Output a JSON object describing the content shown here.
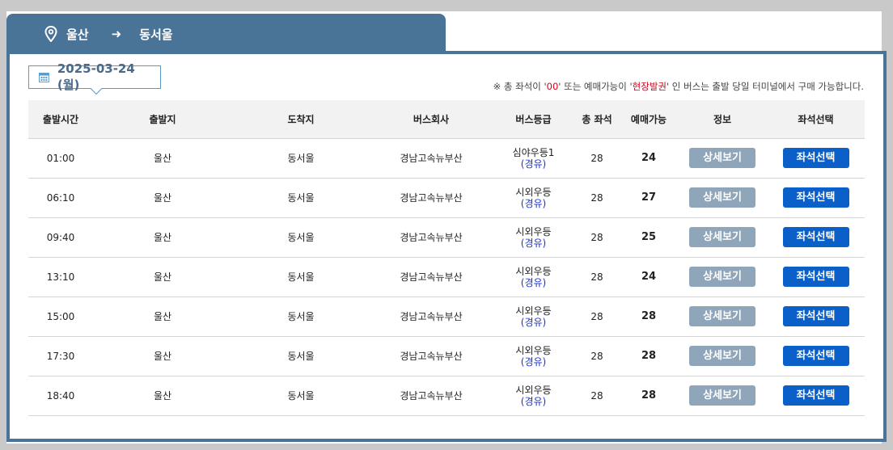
{
  "route": {
    "origin": "울산",
    "destination": "동서울",
    "pin_icon": "location-pin-icon",
    "arrow_icon": "arrow-right-icon"
  },
  "date": {
    "label": "2025-03-24 (월)",
    "icon": "calendar-icon"
  },
  "notice": {
    "prefix": "※ 총 좌석이 '",
    "zero": "00",
    "middle": "' 또는 예매가능이 '",
    "onsite": "현장발권",
    "suffix": "' 인 버스는 출발 당일 터미널에서 구매 가능합니다."
  },
  "columns": [
    "출발시간",
    "출발지",
    "도착지",
    "버스회사",
    "버스등급",
    "총 좌석",
    "예매가능",
    "정보",
    "좌석선택"
  ],
  "buttons": {
    "detail": "상세보기",
    "seat": "좌석선택"
  },
  "rows": [
    {
      "time": "01:00",
      "origin": "울산",
      "dest": "동서울",
      "company": "경남고속뉴부산",
      "grade": "심야우등1",
      "via": "(경유)",
      "total": "28",
      "available": "24"
    },
    {
      "time": "06:10",
      "origin": "울산",
      "dest": "동서울",
      "company": "경남고속뉴부산",
      "grade": "시외우등",
      "via": "(경유)",
      "total": "28",
      "available": "27"
    },
    {
      "time": "09:40",
      "origin": "울산",
      "dest": "동서울",
      "company": "경남고속뉴부산",
      "grade": "시외우등",
      "via": "(경유)",
      "total": "28",
      "available": "25"
    },
    {
      "time": "13:10",
      "origin": "울산",
      "dest": "동서울",
      "company": "경남고속뉴부산",
      "grade": "시외우등",
      "via": "(경유)",
      "total": "28",
      "available": "24"
    },
    {
      "time": "15:00",
      "origin": "울산",
      "dest": "동서울",
      "company": "경남고속뉴부산",
      "grade": "시외우등",
      "via": "(경유)",
      "total": "28",
      "available": "28"
    },
    {
      "time": "17:30",
      "origin": "울산",
      "dest": "동서울",
      "company": "경남고속뉴부산",
      "grade": "시외우등",
      "via": "(경유)",
      "total": "28",
      "available": "28"
    },
    {
      "time": "18:40",
      "origin": "울산",
      "dest": "동서울",
      "company": "경남고속뉴부산",
      "grade": "시외우등",
      "via": "(경유)",
      "total": "28",
      "available": "28"
    }
  ],
  "colors": {
    "header_blue": "#4a7398",
    "seat_button": "#0a5fc8",
    "detail_button": "#8ea5ba",
    "via_text": "#1a33cc",
    "notice_red": "#d0021b"
  }
}
